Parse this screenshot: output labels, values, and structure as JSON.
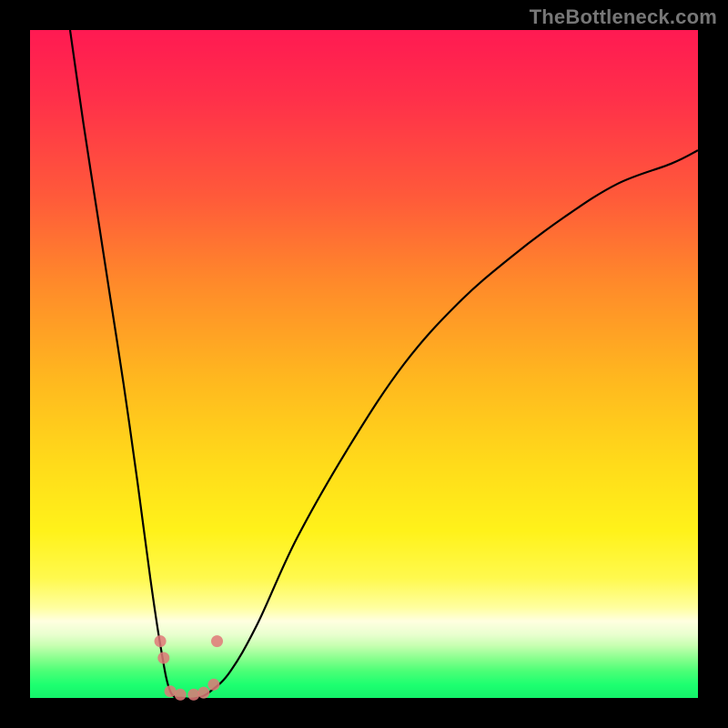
{
  "watermark": "TheBottleneck.com",
  "colors": {
    "frame": "#000000",
    "curve": "#000000",
    "markers": "#e07878",
    "top": "#ff1a52",
    "bottom": "#14f26a"
  },
  "chart_data": {
    "type": "line",
    "title": "",
    "xlabel": "",
    "ylabel": "",
    "xlim": [
      0,
      100
    ],
    "ylim": [
      0,
      100
    ],
    "grid": false,
    "legend": false,
    "note": "No axes, ticks, or numeric labels are shown in the image. Values below are normalized (0–100) positions read off the plotted curve.",
    "series": [
      {
        "name": "curve",
        "x": [
          6,
          8,
          10,
          12,
          14,
          16,
          18,
          19.5,
          21,
          23,
          25,
          27,
          30,
          34,
          40,
          48,
          56,
          64,
          72,
          80,
          88,
          96,
          100
        ],
        "values": [
          100,
          86,
          73,
          60,
          47,
          33,
          18,
          8,
          1,
          0,
          0,
          1,
          4,
          11,
          24,
          38,
          50,
          59,
          66,
          72,
          77,
          80,
          82
        ]
      }
    ],
    "markers": [
      {
        "x": 19.5,
        "y": 8.5
      },
      {
        "x": 20.0,
        "y": 6.0
      },
      {
        "x": 21.0,
        "y": 1.0
      },
      {
        "x": 22.5,
        "y": 0.5
      },
      {
        "x": 24.5,
        "y": 0.5
      },
      {
        "x": 26.0,
        "y": 0.8
      },
      {
        "x": 27.5,
        "y": 2.0
      },
      {
        "x": 28.0,
        "y": 8.5
      }
    ]
  }
}
